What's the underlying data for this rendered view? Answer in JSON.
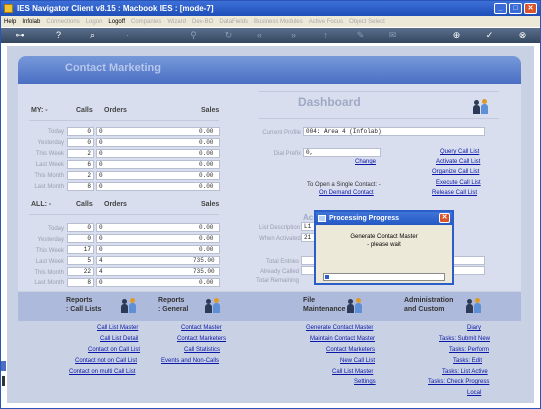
{
  "window": {
    "title": "IES Navigator Client v8.15 : Macbook IES :     [mode-7]"
  },
  "menubar": {
    "items": [
      {
        "label": "Help",
        "enabled": true
      },
      {
        "label": "Infolab",
        "enabled": true
      },
      {
        "label": "Connections",
        "enabled": false
      },
      {
        "label": "Logon",
        "enabled": false
      },
      {
        "label": "Logoff",
        "enabled": true
      },
      {
        "label": "Companies",
        "enabled": false
      },
      {
        "label": "Wizard",
        "enabled": false
      },
      {
        "label": "Dev-BO",
        "enabled": false
      },
      {
        "label": "DataFields",
        "enabled": false
      },
      {
        "label": "Business Modules",
        "enabled": false
      },
      {
        "label": "Active Focus",
        "enabled": false
      },
      {
        "label": "Object Select",
        "enabled": false
      }
    ]
  },
  "page": {
    "title": "Contact Marketing"
  },
  "my": {
    "title": "MY: -",
    "col_calls": "Calls",
    "col_orders": "Orders",
    "col_sales": "Sales",
    "rows": [
      {
        "label": "Today",
        "calls": "0",
        "orders": "0",
        "sales": "0.00"
      },
      {
        "label": "Yesterday",
        "calls": "0",
        "orders": "0",
        "sales": "0.00"
      },
      {
        "label": "This Week",
        "calls": "2",
        "orders": "0",
        "sales": "0.00"
      },
      {
        "label": "Last Week",
        "calls": "6",
        "orders": "0",
        "sales": "0.00"
      },
      {
        "label": "This Month",
        "calls": "2",
        "orders": "0",
        "sales": "0.00"
      },
      {
        "label": "Last Month",
        "calls": "8",
        "orders": "0",
        "sales": "0.00"
      }
    ]
  },
  "all": {
    "title": "ALL: -",
    "col_calls": "Calls",
    "col_orders": "Orders",
    "col_sales": "Sales",
    "rows": [
      {
        "label": "Today",
        "calls": "0",
        "orders": "0",
        "sales": "0.00"
      },
      {
        "label": "Yesterday",
        "calls": "0",
        "orders": "0",
        "sales": "0.00"
      },
      {
        "label": "This Week",
        "calls": "17",
        "orders": "0",
        "sales": "0.00"
      },
      {
        "label": "Last Week",
        "calls": "5",
        "orders": "4",
        "sales": "735.00"
      },
      {
        "label": "This Month",
        "calls": "22",
        "orders": "4",
        "sales": "735.00"
      },
      {
        "label": "Last Month",
        "calls": "8",
        "orders": "0",
        "sales": "0.00"
      }
    ]
  },
  "dashboard": {
    "title": "Dashboard",
    "current_profile_label": "Current Profile",
    "current_profile_value": "004: Area 4 (Infolab)",
    "dial_prefix_label": "Dial Prefix",
    "dial_prefix_value": "0,",
    "change_link": "Change",
    "single_contact_text": "To Open a Single Contact: -",
    "on_demand_link": "On Demand Contact",
    "actions": [
      "Query Call List",
      "Activate Call List",
      "Organize Call List",
      "Execute Call List",
      "Release Call List"
    ]
  },
  "active_list": {
    "title_partial": "Ac",
    "list_description_label": "List Description",
    "list_description_value": "L1",
    "when_activated_label": "When Activated",
    "when_activated_value": "21",
    "total_entries_label": "Total Entries",
    "already_called_label": "Already Called",
    "total_remaining_label": "Total Remaining"
  },
  "modal": {
    "title": "Processing Progress",
    "message_line1": "Generate Contact Master",
    "message_line2": "- please wait",
    "progress_fraction": 0.03
  },
  "nav": {
    "reports_call_lists_1": "Reports",
    "reports_call_lists_2": ": Call Lists",
    "reports_general_1": "Reports",
    "reports_general_2": ": General",
    "file_maint_1": "File",
    "file_maint_2": "Maintenance",
    "admin_1": "Administration",
    "admin_2": "and Custom"
  },
  "links": {
    "col1": [
      "Call List Master",
      "Call List Detail",
      "Contact on Call List",
      "Contact not on Call List",
      "Contact on multi Call List"
    ],
    "col2": [
      "Contact Master",
      "Contact Marketers",
      "Call Statistics",
      "Events and Non-Calls"
    ],
    "col3": [
      "Generate Contact Master",
      "Maintain Contact Master",
      "Contact Marketers",
      "New Call List",
      "Call List Master",
      "Settings"
    ],
    "col4": [
      "Diary",
      "Tasks: Submit New",
      "Tasks: Perform",
      "Tasks: Edit",
      "Tasks: List Active",
      "Tasks: Check Progress",
      "Local"
    ]
  },
  "colors": {
    "titlebar": "#1e4fb8",
    "background": "#c9d1e4",
    "link": "#0b17a6",
    "banner": "#5c80cc"
  }
}
